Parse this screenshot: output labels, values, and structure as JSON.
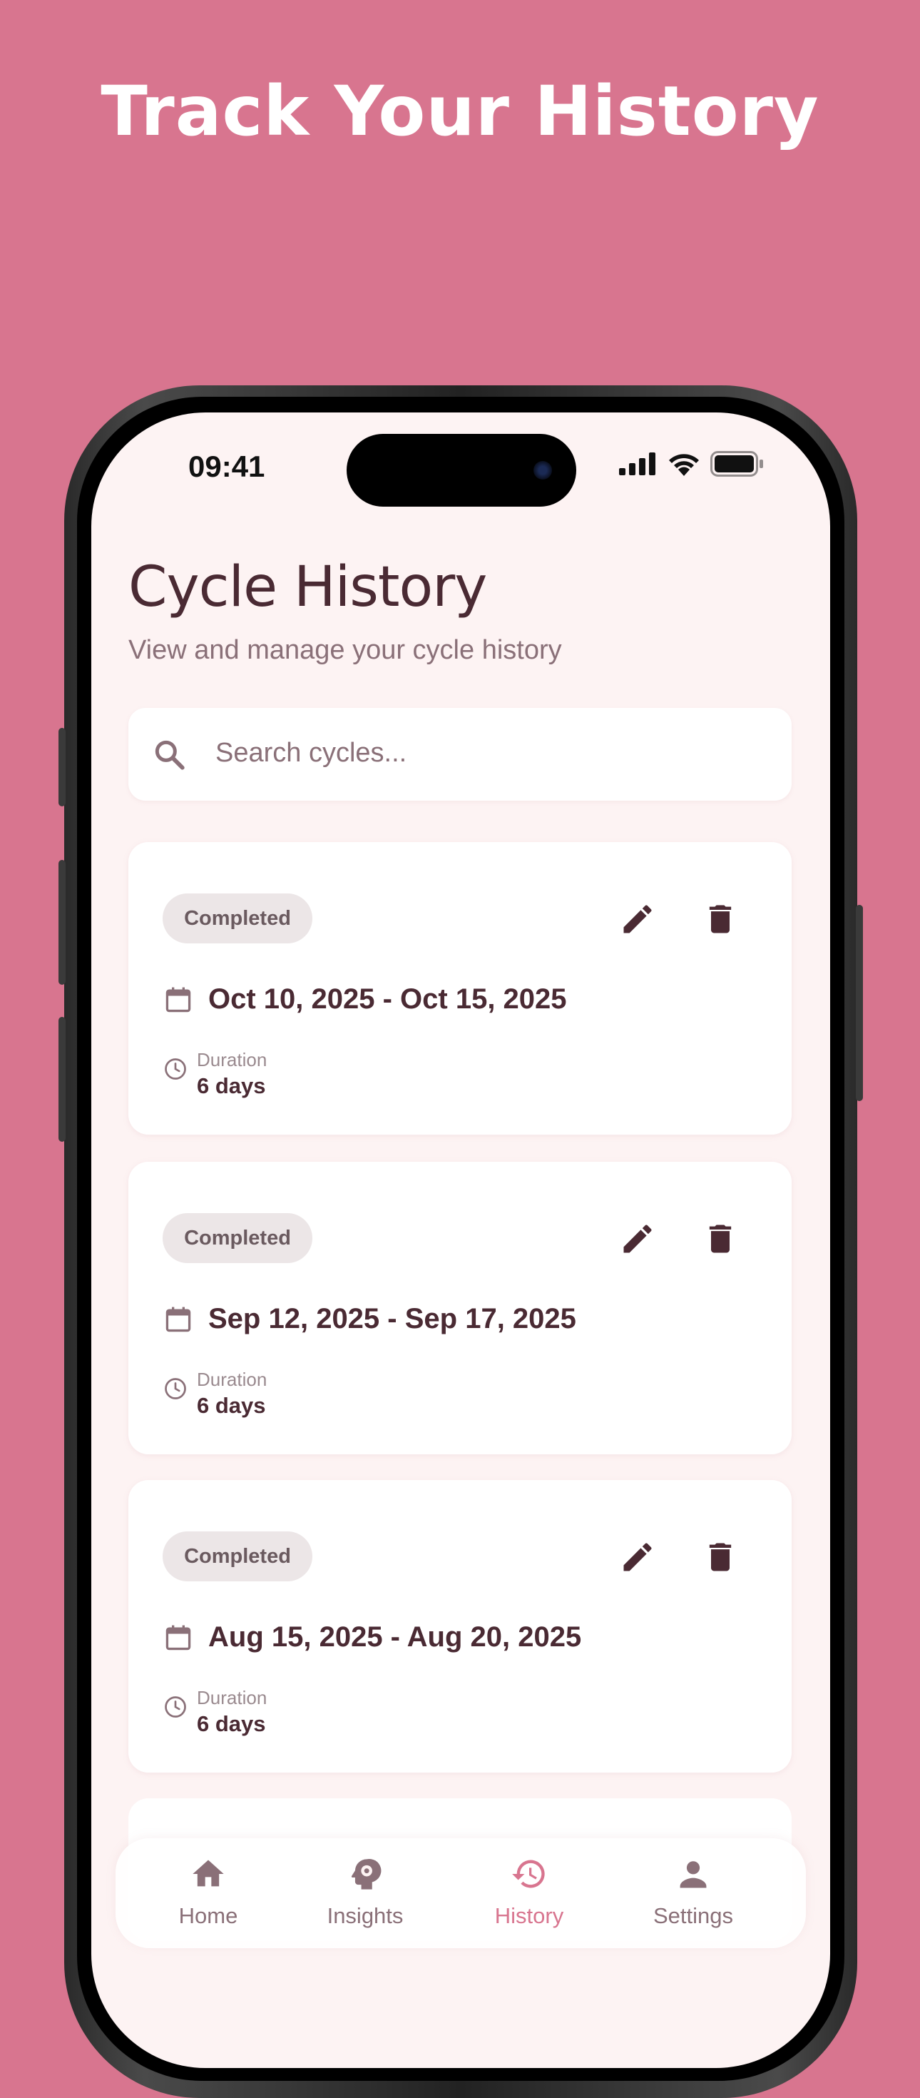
{
  "headline": "Track Your History",
  "status_bar": {
    "time": "09:41"
  },
  "page": {
    "title": "Cycle History",
    "subtitle": "View and manage your cycle history"
  },
  "search": {
    "placeholder": "Search cycles..."
  },
  "cycles": [
    {
      "status": "Completed",
      "dates": "Oct 10, 2025 - Oct 15, 2025",
      "duration_label": "Duration",
      "duration": "6 days"
    },
    {
      "status": "Completed",
      "dates": "Sep 12, 2025 - Sep 17, 2025",
      "duration_label": "Duration",
      "duration": "6 days"
    },
    {
      "status": "Completed",
      "dates": "Aug 15, 2025 - Aug 20, 2025",
      "duration_label": "Duration",
      "duration": "6 days"
    }
  ],
  "nav": {
    "items": [
      {
        "label": "Home",
        "icon": "home-icon"
      },
      {
        "label": "Insights",
        "icon": "brain-gear-icon"
      },
      {
        "label": "History",
        "icon": "history-icon",
        "active": true
      },
      {
        "label": "Settings",
        "icon": "person-icon"
      }
    ]
  },
  "colors": {
    "background": "#d8758f",
    "accent": "#d8758f",
    "text_dark": "#4a2a33",
    "screen_bg": "#fdf3f3"
  }
}
